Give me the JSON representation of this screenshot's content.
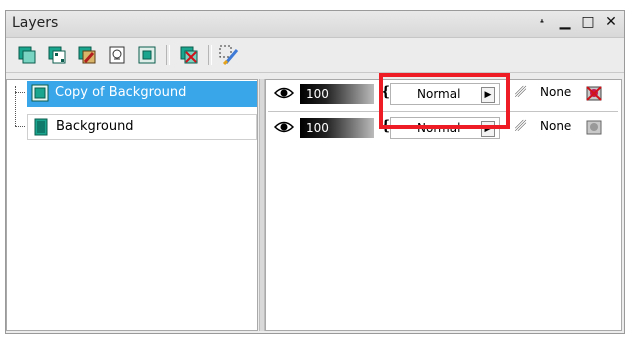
{
  "window": {
    "title": "Layers",
    "buttons": [
      "pin",
      "minimize",
      "maximize",
      "close"
    ]
  },
  "toolbar": {
    "tools": [
      "new-raster-layer-icon",
      "new-vector-layer-icon",
      "new-art-media-layer-icon",
      "new-mask-layer-icon",
      "new-adjustment-layer-icon",
      "delete-layer-icon",
      "edit-selection-icon"
    ]
  },
  "layers": [
    {
      "name": "Copy of Background",
      "selected": true
    },
    {
      "name": "Background",
      "selected": false
    }
  ],
  "properties": [
    {
      "opacity": "100",
      "blend_mode": "Normal",
      "group": "None",
      "enabled": true
    },
    {
      "opacity": "100",
      "blend_mode": "Normal",
      "group": "None",
      "enabled": false
    }
  ],
  "colors": {
    "selection": "#3aa6ea",
    "highlight_box": "#ee1c24"
  }
}
